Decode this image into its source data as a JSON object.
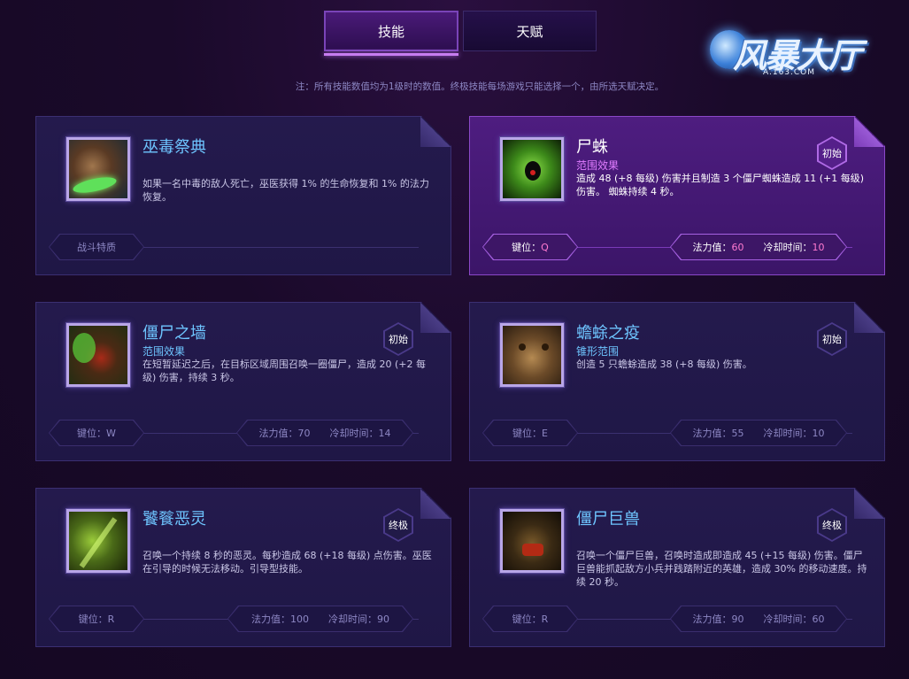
{
  "tabs": {
    "skills": "技能",
    "talents": "天赋"
  },
  "note": "注：所有技能数值均为1级时的数值。终极技能每场游戏只能选择一个，由所选天赋决定。",
  "logo": {
    "text": "风暴大厅",
    "sub": "A.163.COM"
  },
  "labels": {
    "key": "键位：",
    "mana": "法力值：",
    "cooldown": "冷却时间："
  },
  "cards": [
    {
      "title": "巫毒祭典",
      "subtitle": "",
      "desc": "如果一名中毒的敌人死亡，巫医获得 1% 的生命恢复和 1% 的法力恢复。",
      "badge": "",
      "trait": "战斗特质",
      "key": "",
      "mana": "",
      "cooldown": "",
      "icon": "voodoo-ritual-icon"
    },
    {
      "title": "尸蛛",
      "subtitle": "范围效果",
      "desc": "造成 48 (+8 每级) 伤害并且制造 3 个僵尸蜘蛛造成 11 (+1 每级) 伤害。 蜘蛛持续 4 秒。",
      "badge": "初始",
      "trait": "",
      "key": "Q",
      "mana": "60",
      "cooldown": "10",
      "icon": "corpse-spiders-icon"
    },
    {
      "title": "僵尸之墙",
      "subtitle": "范围效果",
      "desc": "在短暂延迟之后，在目标区域周围召唤一圈僵尸，造成 20 (+2 每级) 伤害，持续 3 秒。",
      "badge": "初始",
      "trait": "",
      "key": "W",
      "mana": "70",
      "cooldown": "14",
      "icon": "zombie-wall-icon"
    },
    {
      "title": "蟾蜍之疫",
      "subtitle": "锥形范围",
      "desc": "创造 5 只蟾蜍造成 38 (+8 每级) 伤害。",
      "badge": "初始",
      "trait": "",
      "key": "E",
      "mana": "55",
      "cooldown": "10",
      "icon": "plague-of-toads-icon"
    },
    {
      "title": "饕餮恶灵",
      "subtitle": "",
      "desc": "召唤一个持续 8 秒的恶灵。每秒造成 68 (+18 每级) 点伤害。巫医在引导的时候无法移动。引导型技能。",
      "badge": "终极",
      "trait": "",
      "key": "R",
      "mana": "100",
      "cooldown": "90",
      "icon": "ravenous-spirit-icon"
    },
    {
      "title": "僵尸巨兽",
      "subtitle": "",
      "desc": "召唤一个僵尸巨兽，召唤时造成即造成 45 (+15 每级) 伤害。僵尸巨兽能抓起敌方小兵并践踏附近的英雄，造成 30% 的移动速度。持续 20 秒。",
      "badge": "终极",
      "trait": "",
      "key": "R",
      "mana": "90",
      "cooldown": "60",
      "icon": "gargantuan-icon"
    }
  ]
}
